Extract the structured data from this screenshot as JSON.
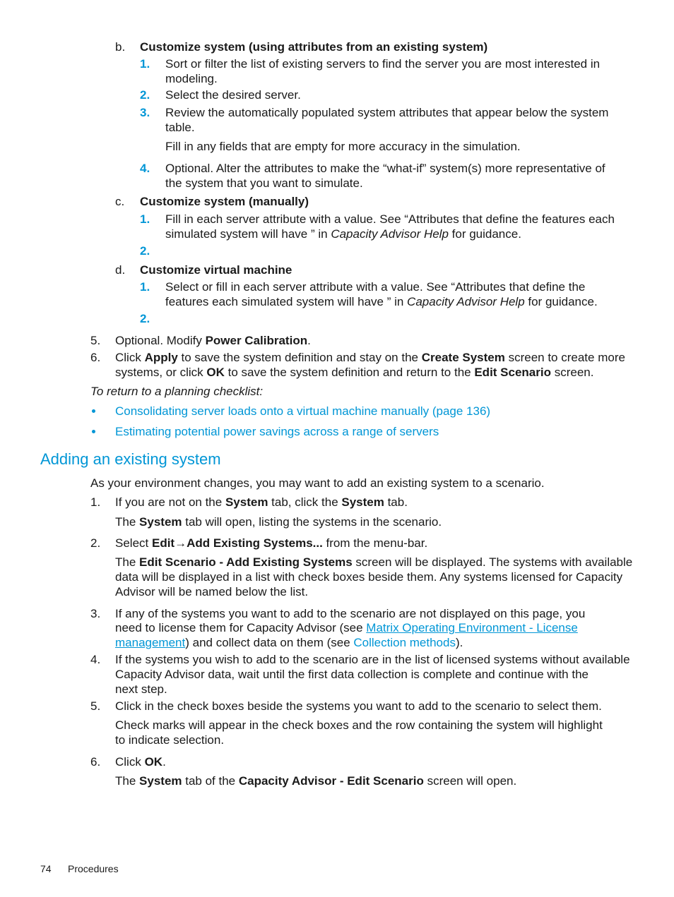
{
  "steps_b": {
    "marker": "b.",
    "title": "Customize system (using attributes from an existing system)",
    "items": [
      {
        "num": "1.",
        "lines": [
          "Sort or filter the list of existing servers to find the server you are most interested in",
          "modeling."
        ]
      },
      {
        "num": "2.",
        "lines": [
          "Select the desired server."
        ]
      },
      {
        "num": "3.",
        "lines": [
          "Review the automatically populated system attributes that appear below the system",
          "table."
        ],
        "note": "Fill in any fields that are empty for more accuracy in the simulation."
      },
      {
        "num": "4.",
        "lines": [
          "Optional. Alter the attributes to make the “what-if” system(s) more representative of",
          "the system that you want to simulate."
        ]
      }
    ]
  },
  "steps_c": {
    "marker": "c.",
    "title": "Customize system (manually)",
    "item1_num": "1.",
    "item1_line1": "Fill in each server attribute with a value. See “Attributes that define the features each",
    "item1_line2_pre": "simulated system will have ” in ",
    "item1_line2_italic": "Capacity Advisor Help",
    "item1_line2_post": " for guidance.",
    "item2_num": "2."
  },
  "steps_d": {
    "marker": "d.",
    "title": "Customize virtual machine",
    "item1_num": "1.",
    "item1_line1": "Select or fill in each server attribute with a value. See “Attributes that define the",
    "item1_line2_pre": "features each simulated system will have ” in ",
    "item1_line2_italic": "Capacity Advisor Help",
    "item1_line2_post": " for guidance.",
    "item2_num": "2."
  },
  "step5": {
    "num": "5.",
    "pre": "Optional. Modify ",
    "bold": "Power Calibration",
    "post": "."
  },
  "step6": {
    "num": "6.",
    "l1_a": "Click ",
    "l1_b": "Apply",
    "l1_c": " to save the system definition and stay on the ",
    "l1_d": "Create System",
    "l1_e": " screen to create more",
    "l2_a": "systems, or click ",
    "l2_b": "OK",
    "l2_c": " to save the system definition and return to the ",
    "l2_d": "Edit Scenario",
    "l2_e": " screen."
  },
  "return_label": "To return to a planning checklist:",
  "checklist_links": [
    "Consolidating server loads onto a virtual machine manually (page 136)",
    "Estimating potential power savings across a range of servers"
  ],
  "section": {
    "heading": "Adding an existing system",
    "intro": "As your environment changes, you may want to add an existing system to a scenario.",
    "s1": {
      "num": "1.",
      "a": "If you are not on the ",
      "b": "System",
      "c": " tab, click the ",
      "d": "System",
      "e": " tab.",
      "note_a": "The ",
      "note_b": "System",
      "note_c": " tab will open, listing the systems in the scenario."
    },
    "s2": {
      "num": "2.",
      "a": "Select ",
      "b": "Edit",
      "arrow": "→",
      "c": "Add Existing Systems...",
      "d": " from the menu-bar.",
      "note1_a": "The ",
      "note1_b": "Edit Scenario - Add Existing Systems",
      "note1_c": " screen will be displayed. The systems with available",
      "note2": "data will be displayed in a list with check boxes beside them. Any systems licensed for Capacity",
      "note3": "Advisor will be named below the list."
    },
    "s3": {
      "num": "3.",
      "l1": "If any of the systems you want to add to the scenario are not displayed on this page, you",
      "l2_a": "need to license them for Capacity Advisor (see ",
      "l2_link": "Matrix Operating Environment - License",
      "l3_link": "management",
      "l3_a": ") and collect data on them (see ",
      "l3_link2": "Collection methods",
      "l3_b": ")."
    },
    "s4": {
      "num": "4.",
      "l1": "If the systems you wish to add to the scenario are in the list of licensed systems without available",
      "l2": "Capacity Advisor data, wait until the first data collection is complete and continue with the",
      "l3": "next step."
    },
    "s5": {
      "num": "5.",
      "l1": "Click in the check boxes beside the systems you want to add to the scenario to select them.",
      "note1": "Check marks will appear in the check boxes and the row containing the system will highlight",
      "note2": "to indicate selection."
    },
    "s6": {
      "num": "6.",
      "a": "Click ",
      "b": "OK",
      "c": ".",
      "note_a": "The ",
      "note_b": "System",
      "note_c": " tab of the ",
      "note_d": "Capacity Advisor - Edit Scenario",
      "note_e": " screen will open."
    }
  },
  "footer": {
    "page_number": "74",
    "section": "Procedures"
  }
}
